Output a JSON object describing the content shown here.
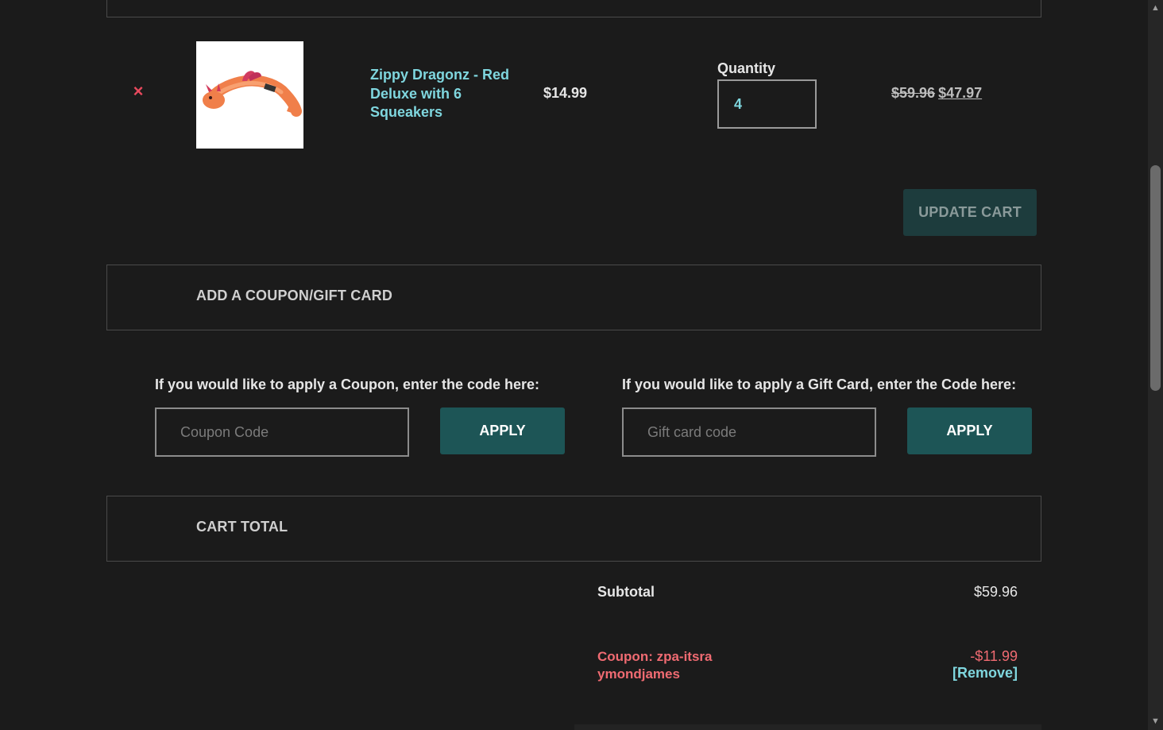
{
  "cart_item": {
    "remove_glyph": "×",
    "image_alt": "dragon-toy-image",
    "product_name": "Zippy Dragonz - Red Deluxe with 6 Squeakers",
    "unit_price": "$14.99",
    "quantity_label": "Quantity",
    "quantity_value": "4",
    "original_total": "$59.96",
    "discounted_total": "$47.97"
  },
  "update_cart_label": "UPDATE CART",
  "coupon_section": {
    "title": "ADD A COUPON/GIFT CARD",
    "coupon_hint": "If you would like to apply a Coupon, enter the code here:",
    "coupon_placeholder": "Coupon Code",
    "coupon_apply_label": "APPLY",
    "gift_hint": "If you would like to apply a Gift Card, enter the Code here:",
    "gift_placeholder": "Gift card code",
    "gift_apply_label": "APPLY"
  },
  "cart_total": {
    "title": "CART TOTAL",
    "subtotal_label": "Subtotal",
    "subtotal_value": "$59.96",
    "coupon_label": "Coupon: zpa-itsraymondjames",
    "coupon_value": "-$11.99",
    "coupon_remove_label": "[Remove]"
  },
  "colors": {
    "background": "#1b1b1b",
    "link": "#7fd6de",
    "danger": "#e8495d",
    "button": "#1d5556"
  },
  "icons": {
    "scroll_up": "▲",
    "scroll_down": "▼"
  }
}
